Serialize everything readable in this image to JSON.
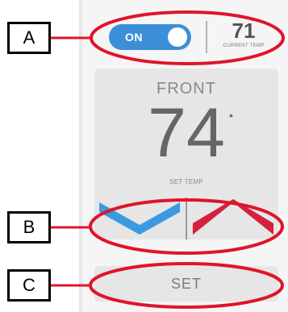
{
  "toggle": {
    "label": "ON",
    "state": "on",
    "color": "#3b8fd9"
  },
  "current": {
    "value": "71",
    "degree": "°",
    "label": "CURRENT TEMP"
  },
  "zone": {
    "name": "FRONT"
  },
  "setpoint": {
    "value": "74",
    "degree": "•",
    "label": "SET TEMP"
  },
  "controls": {
    "down_icon": "chevron-down-icon",
    "up_icon": "chevron-up-icon",
    "down_color": "#3a9ae0",
    "up_color": "#d6203f"
  },
  "set_button": {
    "label": "SET"
  },
  "callouts": {
    "a": "A",
    "b": "B",
    "c": "C",
    "color": "#e0142a"
  }
}
